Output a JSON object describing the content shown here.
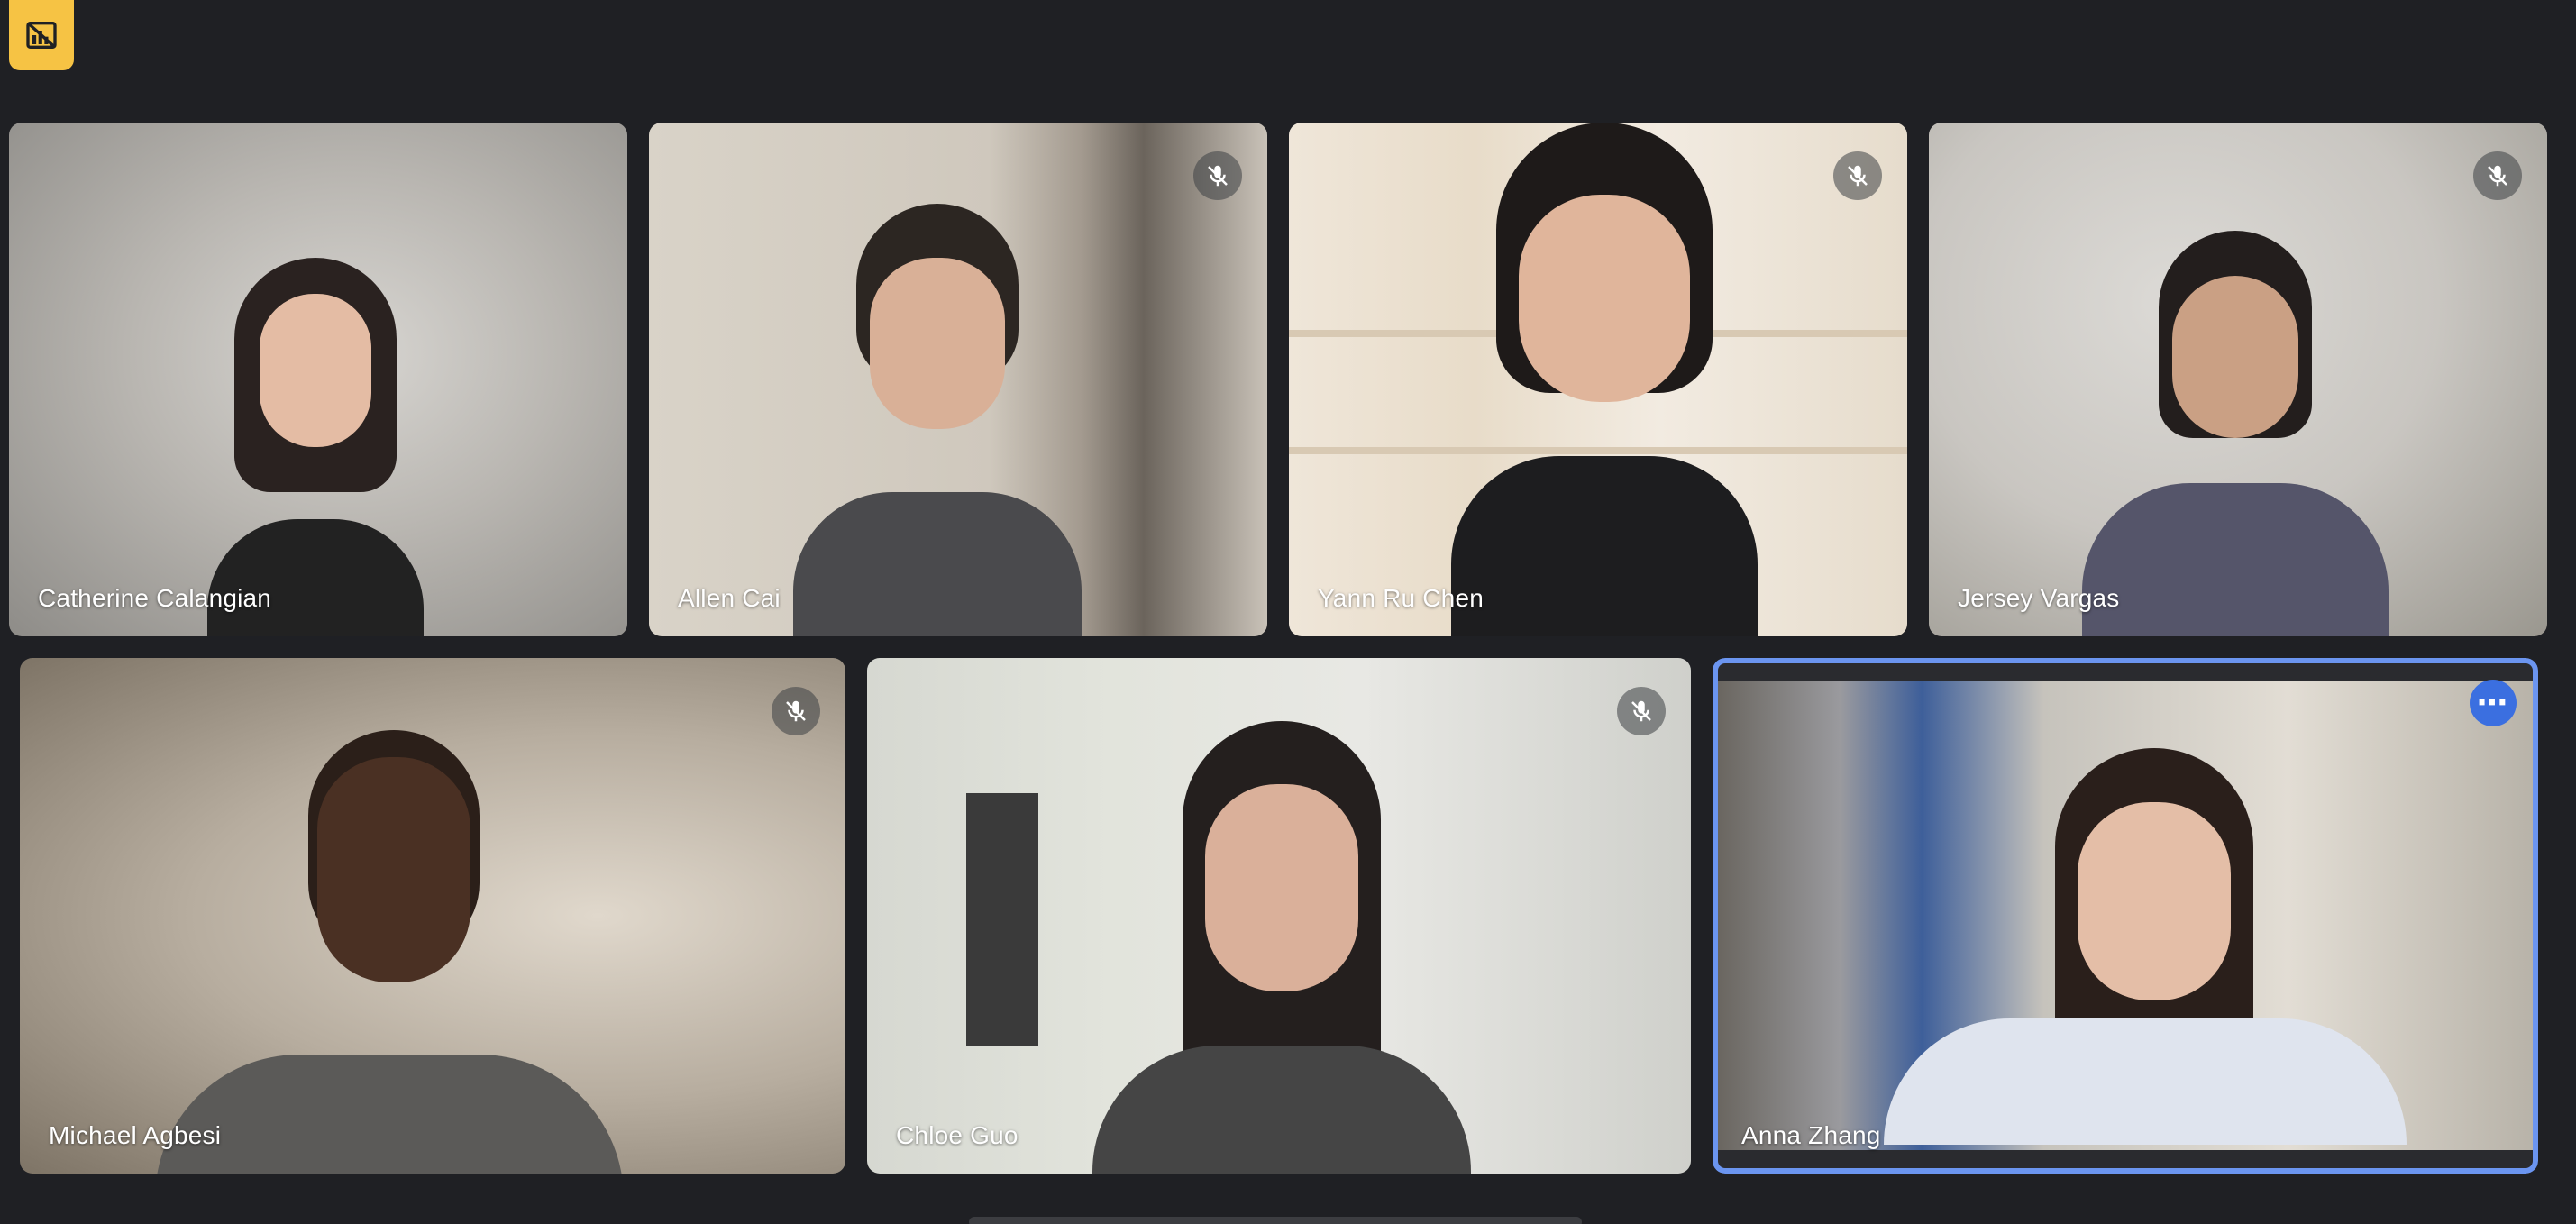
{
  "participants": [
    {
      "name": "Catherine Calangian",
      "muted": false
    },
    {
      "name": "Allen Cai",
      "muted": true
    },
    {
      "name": "Yann Ru Chen",
      "muted": true
    },
    {
      "name": "Jersey Vargas",
      "muted": true
    },
    {
      "name": "Michael Agbesi",
      "muted": true
    },
    {
      "name": "Chloe Guo",
      "muted": true
    },
    {
      "name": "Anna Zhang",
      "muted": false,
      "active_speaker": true
    }
  ],
  "icons": {
    "top_badge": "camera-off-icon",
    "mic": "mic-off-icon",
    "more": "more-options-icon"
  },
  "colors": {
    "background": "#202124",
    "badge": "#f6c344",
    "active_border": "#6b95f0",
    "more_button": "#3b6fe0"
  }
}
